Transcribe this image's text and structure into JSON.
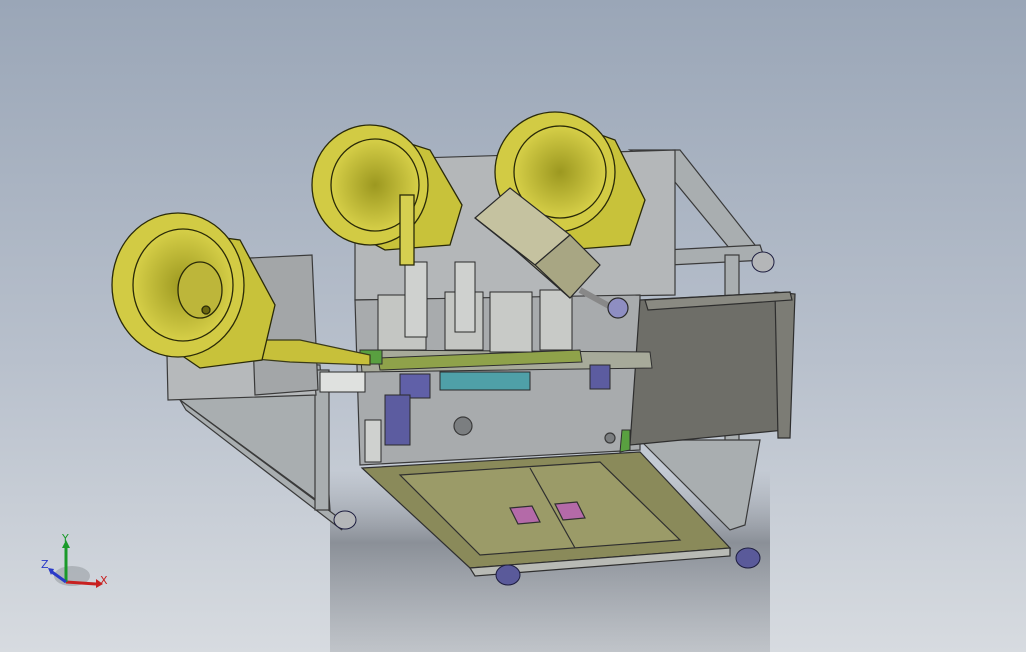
{
  "view": {
    "background_top": "#9aa6b7",
    "background_bottom": "#d7dbe0"
  },
  "model": {
    "parts": [
      {
        "name": "vibratory-bowl-left",
        "color": "#c8c23a"
      },
      {
        "name": "vibratory-bowl-center",
        "color": "#c8c23a"
      },
      {
        "name": "vibratory-bowl-right",
        "color": "#c8c23a"
      },
      {
        "name": "base-frame",
        "color": "#a9aeb0"
      },
      {
        "name": "base-tray",
        "color": "#8a8a5a"
      },
      {
        "name": "control-panel",
        "color": "#6e6e68"
      },
      {
        "name": "cylinder-block",
        "color": "#b9b79a"
      },
      {
        "name": "casters",
        "color": "#4a4a86"
      }
    ]
  },
  "triad": {
    "x_label": "X",
    "y_label": "Y",
    "z_label": "Z",
    "x_color": "#c82020",
    "y_color": "#1a9a2a",
    "z_color": "#2a3ac8"
  }
}
